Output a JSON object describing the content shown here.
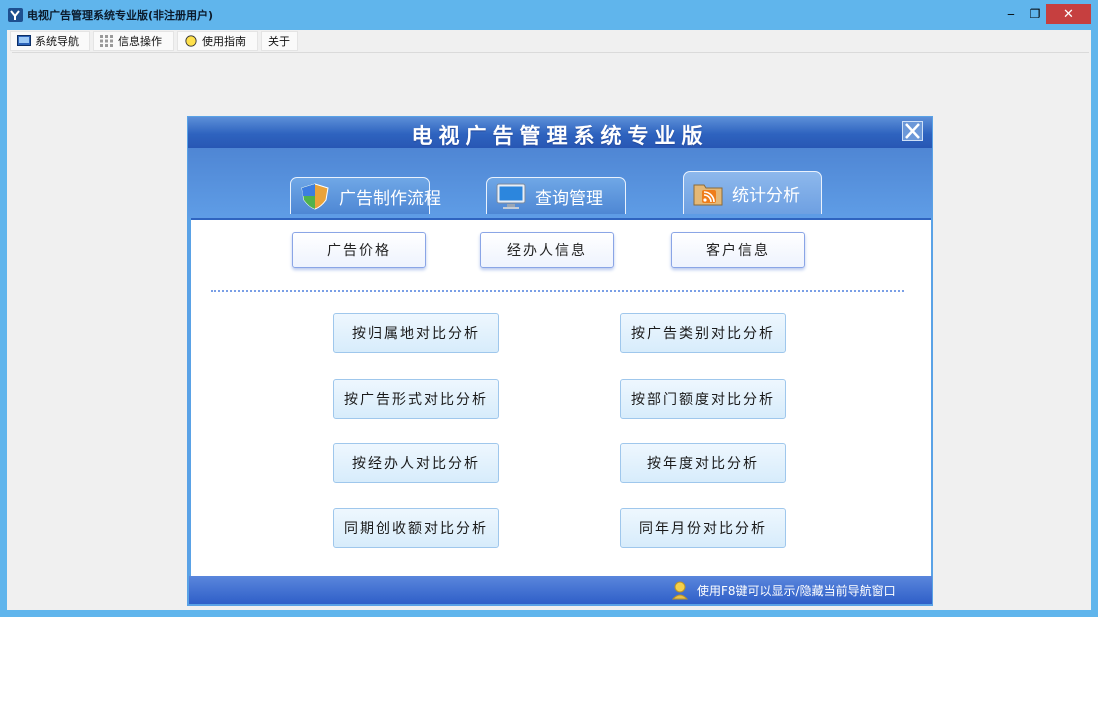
{
  "window": {
    "title": "电视广告管理系统专业版(非注册用户)",
    "controls": {
      "minimize": "‒",
      "maximize": "❐",
      "close": "✕"
    }
  },
  "menu": [
    {
      "label": "系统导航",
      "icon": "monitor-icon"
    },
    {
      "label": "信息操作",
      "icon": "grid-icon"
    },
    {
      "label": "使用指南",
      "icon": "lightbulb-icon"
    },
    {
      "label": "关于",
      "icon": ""
    }
  ],
  "panel": {
    "title": "电视广告管理系统专业版",
    "tabs": [
      {
        "label": "广告制作流程",
        "icon": "shield-icon"
      },
      {
        "label": "查询管理",
        "icon": "monitor-icon"
      },
      {
        "label": "统计分析",
        "icon": "rss-folder-icon",
        "active": true
      }
    ],
    "sub_buttons": [
      "广告价格",
      "经办人信息",
      "客户信息"
    ],
    "buttons": {
      "left": [
        "按归属地对比分析",
        "按广告形式对比分析",
        "按经办人对比分析",
        "同期创收额对比分析"
      ],
      "right": [
        "按广告类别对比分析",
        "按部门额度对比分析",
        "按年度对比分析",
        "同年月份对比分析"
      ]
    },
    "footer_hint": "使用F8键可以显示/隐藏当前导航窗口"
  },
  "colors": {
    "frame": "#60b5ec",
    "close_button": "#c63f3f",
    "panel_header": "#2e63bf",
    "tab_bg": "#5aa2e6",
    "button_border": "#9fc7ec"
  }
}
